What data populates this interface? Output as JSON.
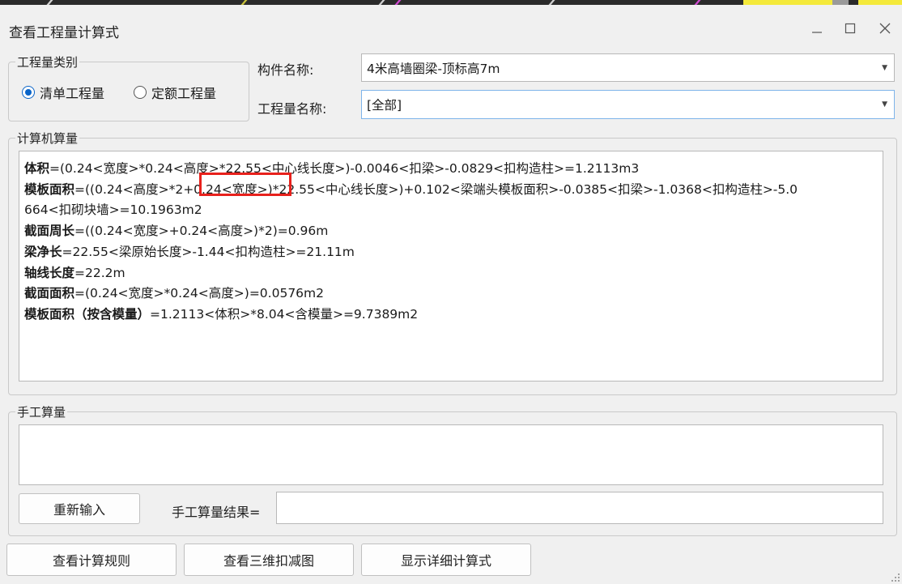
{
  "window": {
    "title": "查看工程量计算式",
    "controls": {
      "minimize": "—",
      "maximize": "☐",
      "close": "✕"
    }
  },
  "quantity_type": {
    "legend": "工程量类别",
    "options": [
      {
        "label": "清单工程量",
        "selected": true
      },
      {
        "label": "定额工程量",
        "selected": false
      }
    ]
  },
  "component": {
    "label": "构件名称:",
    "value": "4米高墙圈梁-顶标高7m"
  },
  "quantity_name": {
    "label": "工程量名称:",
    "value": "[全部]"
  },
  "computer_calc": {
    "legend": "计算机算量",
    "lines": [
      {
        "name": "体积",
        "text": "=(0.24<宽度>*0.24<高度>*22.55<中心线长度>)-0.0046<扣梁>-0.0829<扣构造柱>=1.2113m3"
      },
      {
        "name": "模板面积",
        "text": "=((0.24<高度>*2+0.24<宽度>)*22.55<中心线长度>)+0.102<梁端头模板面积>-0.0385<扣梁>-1.0368<扣构造柱>-5.0"
      },
      {
        "name": "",
        "text": "664<扣砌块墙>=10.1963m2"
      },
      {
        "name": "截面周长",
        "text": "=((0.24<宽度>+0.24<高度>)*2)=0.96m"
      },
      {
        "name": "梁净长",
        "text": "=22.55<梁原始长度>-1.44<扣构造柱>=21.11m"
      },
      {
        "name": "轴线长度",
        "text": "=22.2m"
      },
      {
        "name": "截面面积",
        "text": "=(0.24<宽度>*0.24<高度>)=0.0576m2"
      },
      {
        "name": "模板面积（按含模量）",
        "text": "=1.2113<体积>*8.04<含模量>=9.7389m2"
      }
    ],
    "highlight_color": "#e8211c"
  },
  "manual_calc": {
    "legend": "手工算量",
    "reenter_button": "重新输入",
    "result_label": "手工算量结果=",
    "result_value": ""
  },
  "footer": {
    "view_rules": "查看计算规则",
    "view_3d": "查看三维扣减图",
    "show_detail": "显示详细计算式"
  },
  "colors": {
    "accent": "#0a64c8",
    "highlight": "#e8211c",
    "topbar_yellow": "#f4e93a"
  }
}
